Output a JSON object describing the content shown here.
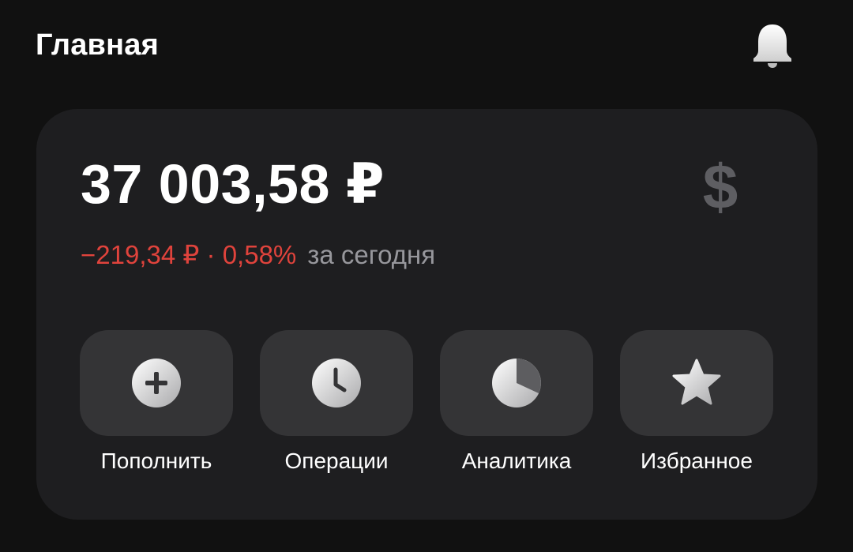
{
  "header": {
    "title": "Главная",
    "notifications_icon": "bell-icon"
  },
  "balance_card": {
    "amount": "37 003,58 ₽",
    "currency_icon": "dollar-icon",
    "daily_change": {
      "value": "−219,34 ₽ · 0,58%",
      "period": "за сегодня",
      "color": "#e0433c"
    },
    "actions": [
      {
        "label": "Пополнить",
        "icon": "plus-circle-icon"
      },
      {
        "label": "Операции",
        "icon": "clock-icon"
      },
      {
        "label": "Аналитика",
        "icon": "pie-chart-icon"
      },
      {
        "label": "Избранное",
        "icon": "star-icon"
      }
    ]
  },
  "colors": {
    "background": "#111111",
    "card": "#1e1e20",
    "tile": "#343436",
    "negative": "#e0433c",
    "muted_text": "#97979c"
  }
}
